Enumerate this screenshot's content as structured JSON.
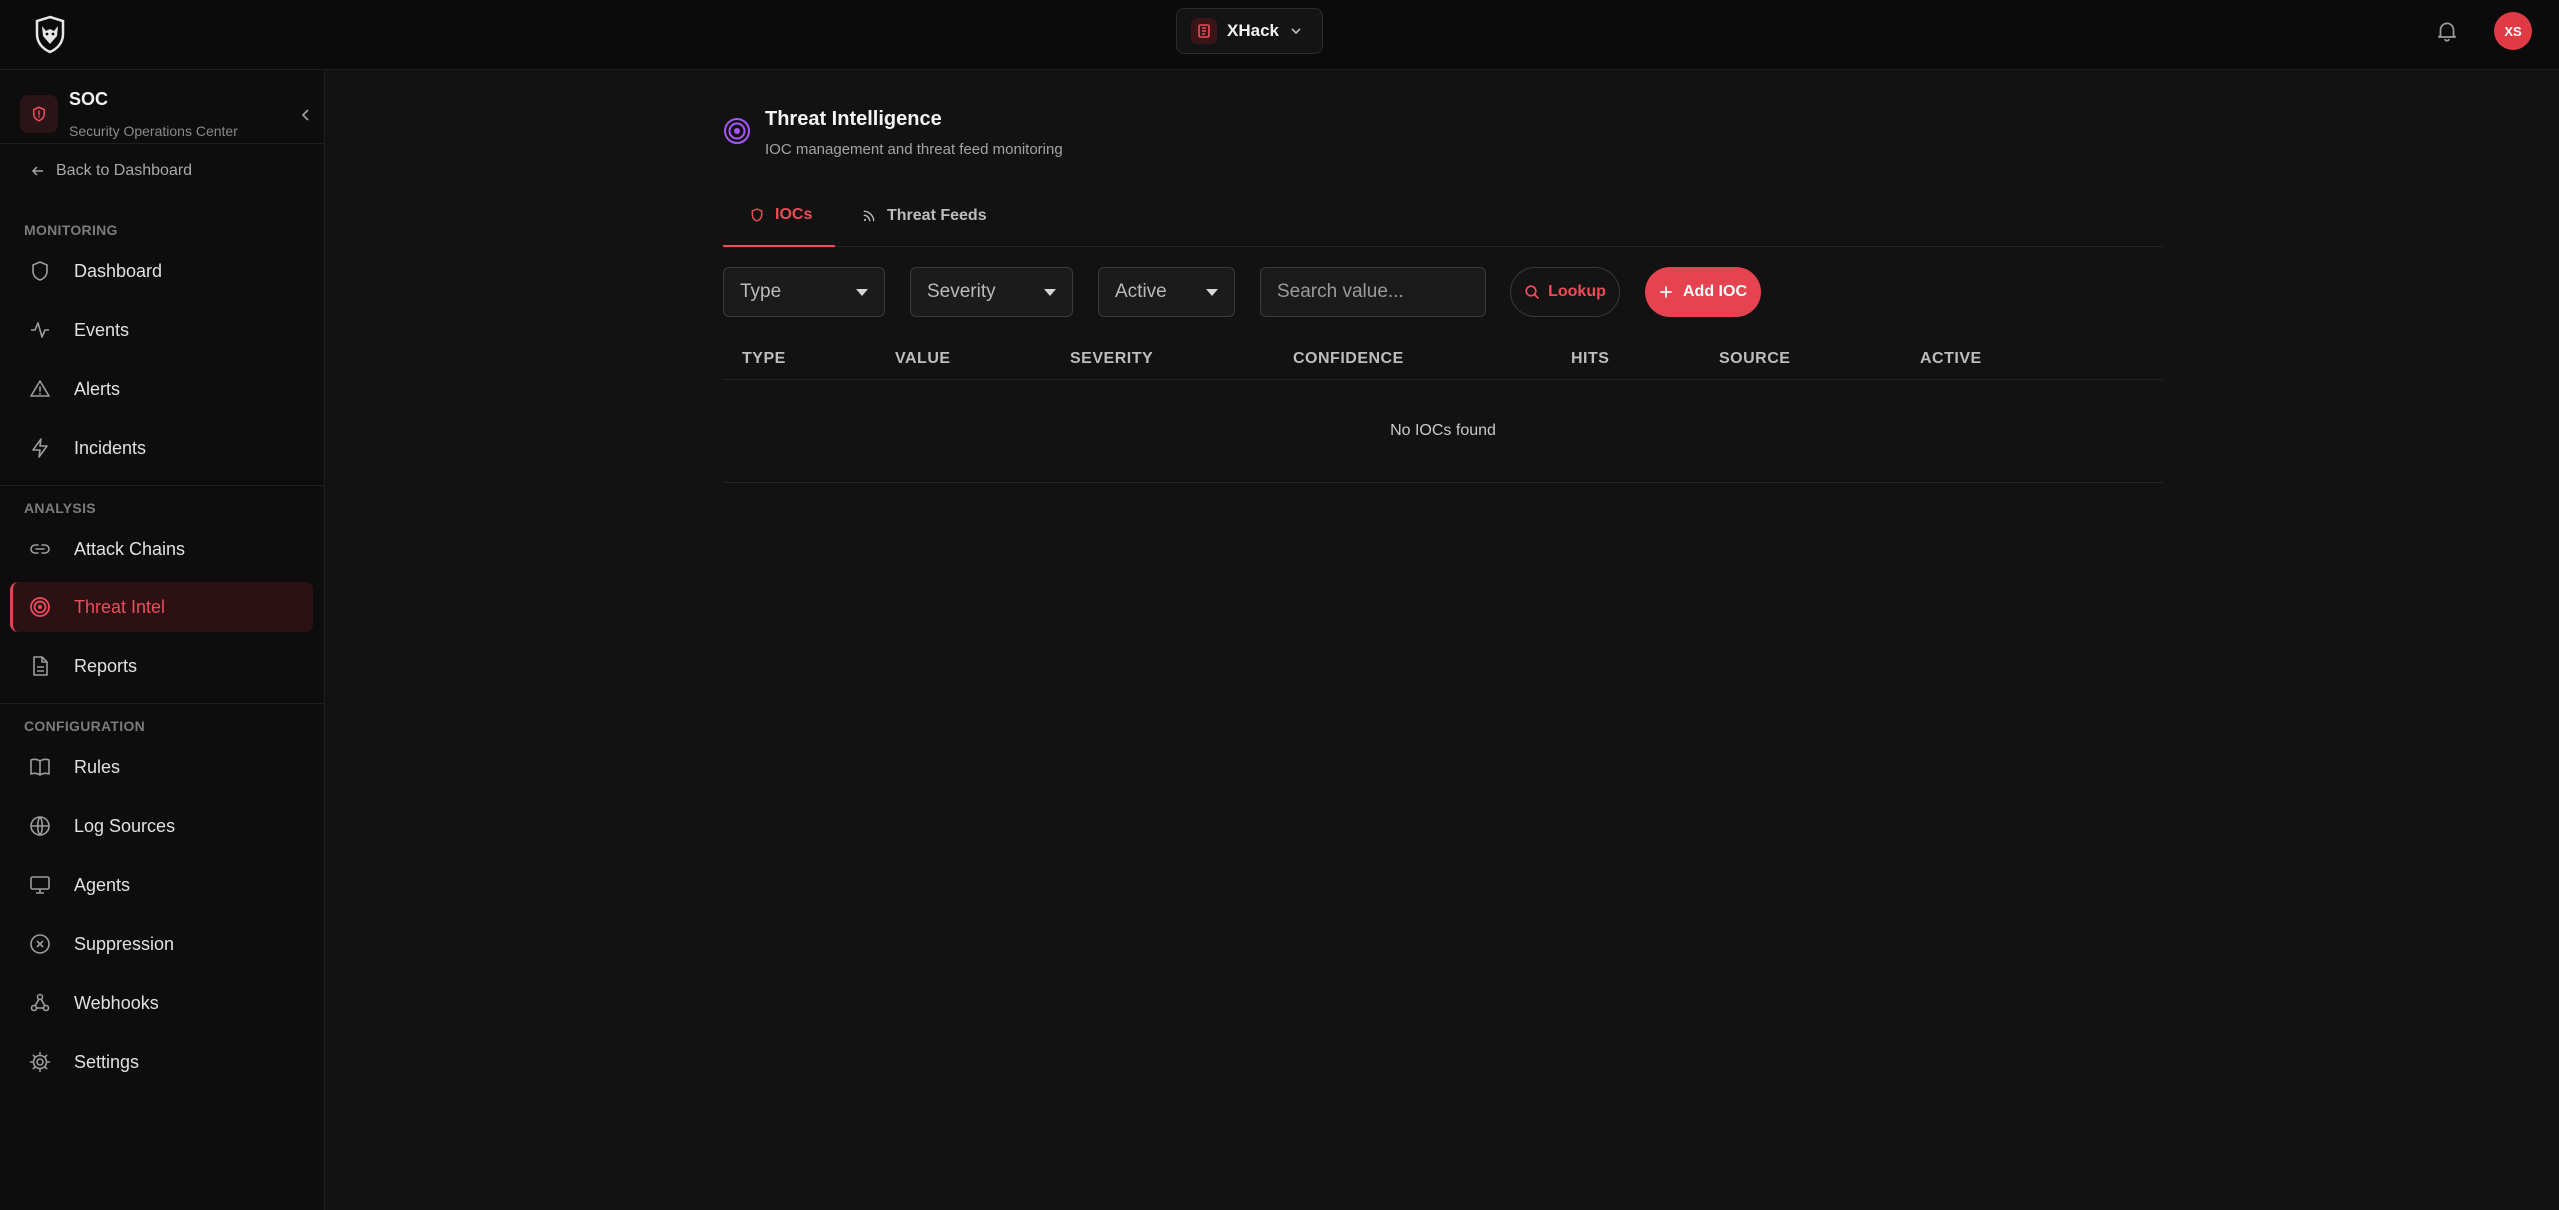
{
  "topbar": {
    "workspace_name": "XHack",
    "user_initials": "XS"
  },
  "sidebar": {
    "app_title": "SOC",
    "app_subtitle": "Security Operations Center",
    "back_label": "Back to Dashboard",
    "sections": {
      "monitoring": "MONITORING",
      "analysis": "ANALYSIS",
      "configuration": "CONFIGURATION"
    },
    "items": {
      "dashboard": "Dashboard",
      "events": "Events",
      "alerts": "Alerts",
      "incidents": "Incidents",
      "attack_chains": "Attack Chains",
      "threat_intel": "Threat Intel",
      "reports": "Reports",
      "rules": "Rules",
      "log_sources": "Log Sources",
      "agents": "Agents",
      "suppression": "Suppression",
      "webhooks": "Webhooks",
      "settings": "Settings"
    },
    "active_item": "threat_intel"
  },
  "main": {
    "title": "Threat Intelligence",
    "subtitle": "IOC management and threat feed monitoring",
    "tabs": {
      "iocs": "IOCs",
      "threat_feeds": "Threat Feeds"
    },
    "filters": {
      "type": "Type",
      "severity": "Severity",
      "active": "Active",
      "search_placeholder": "Search value...",
      "lookup_label": "Lookup",
      "add_label": "Add IOC"
    },
    "table": {
      "columns": {
        "type": "TYPE",
        "value": "VALUE",
        "severity": "SEVERITY",
        "confidence": "CONFIDENCE",
        "hits": "HITS",
        "source": "SOURCE",
        "active": "ACTIVE"
      },
      "empty_message": "No IOCs found"
    }
  },
  "colors": {
    "accent": "#e4434f",
    "background": "#121212",
    "sidebar": "#0d0d0d",
    "threat_icon": "#a855f7"
  }
}
